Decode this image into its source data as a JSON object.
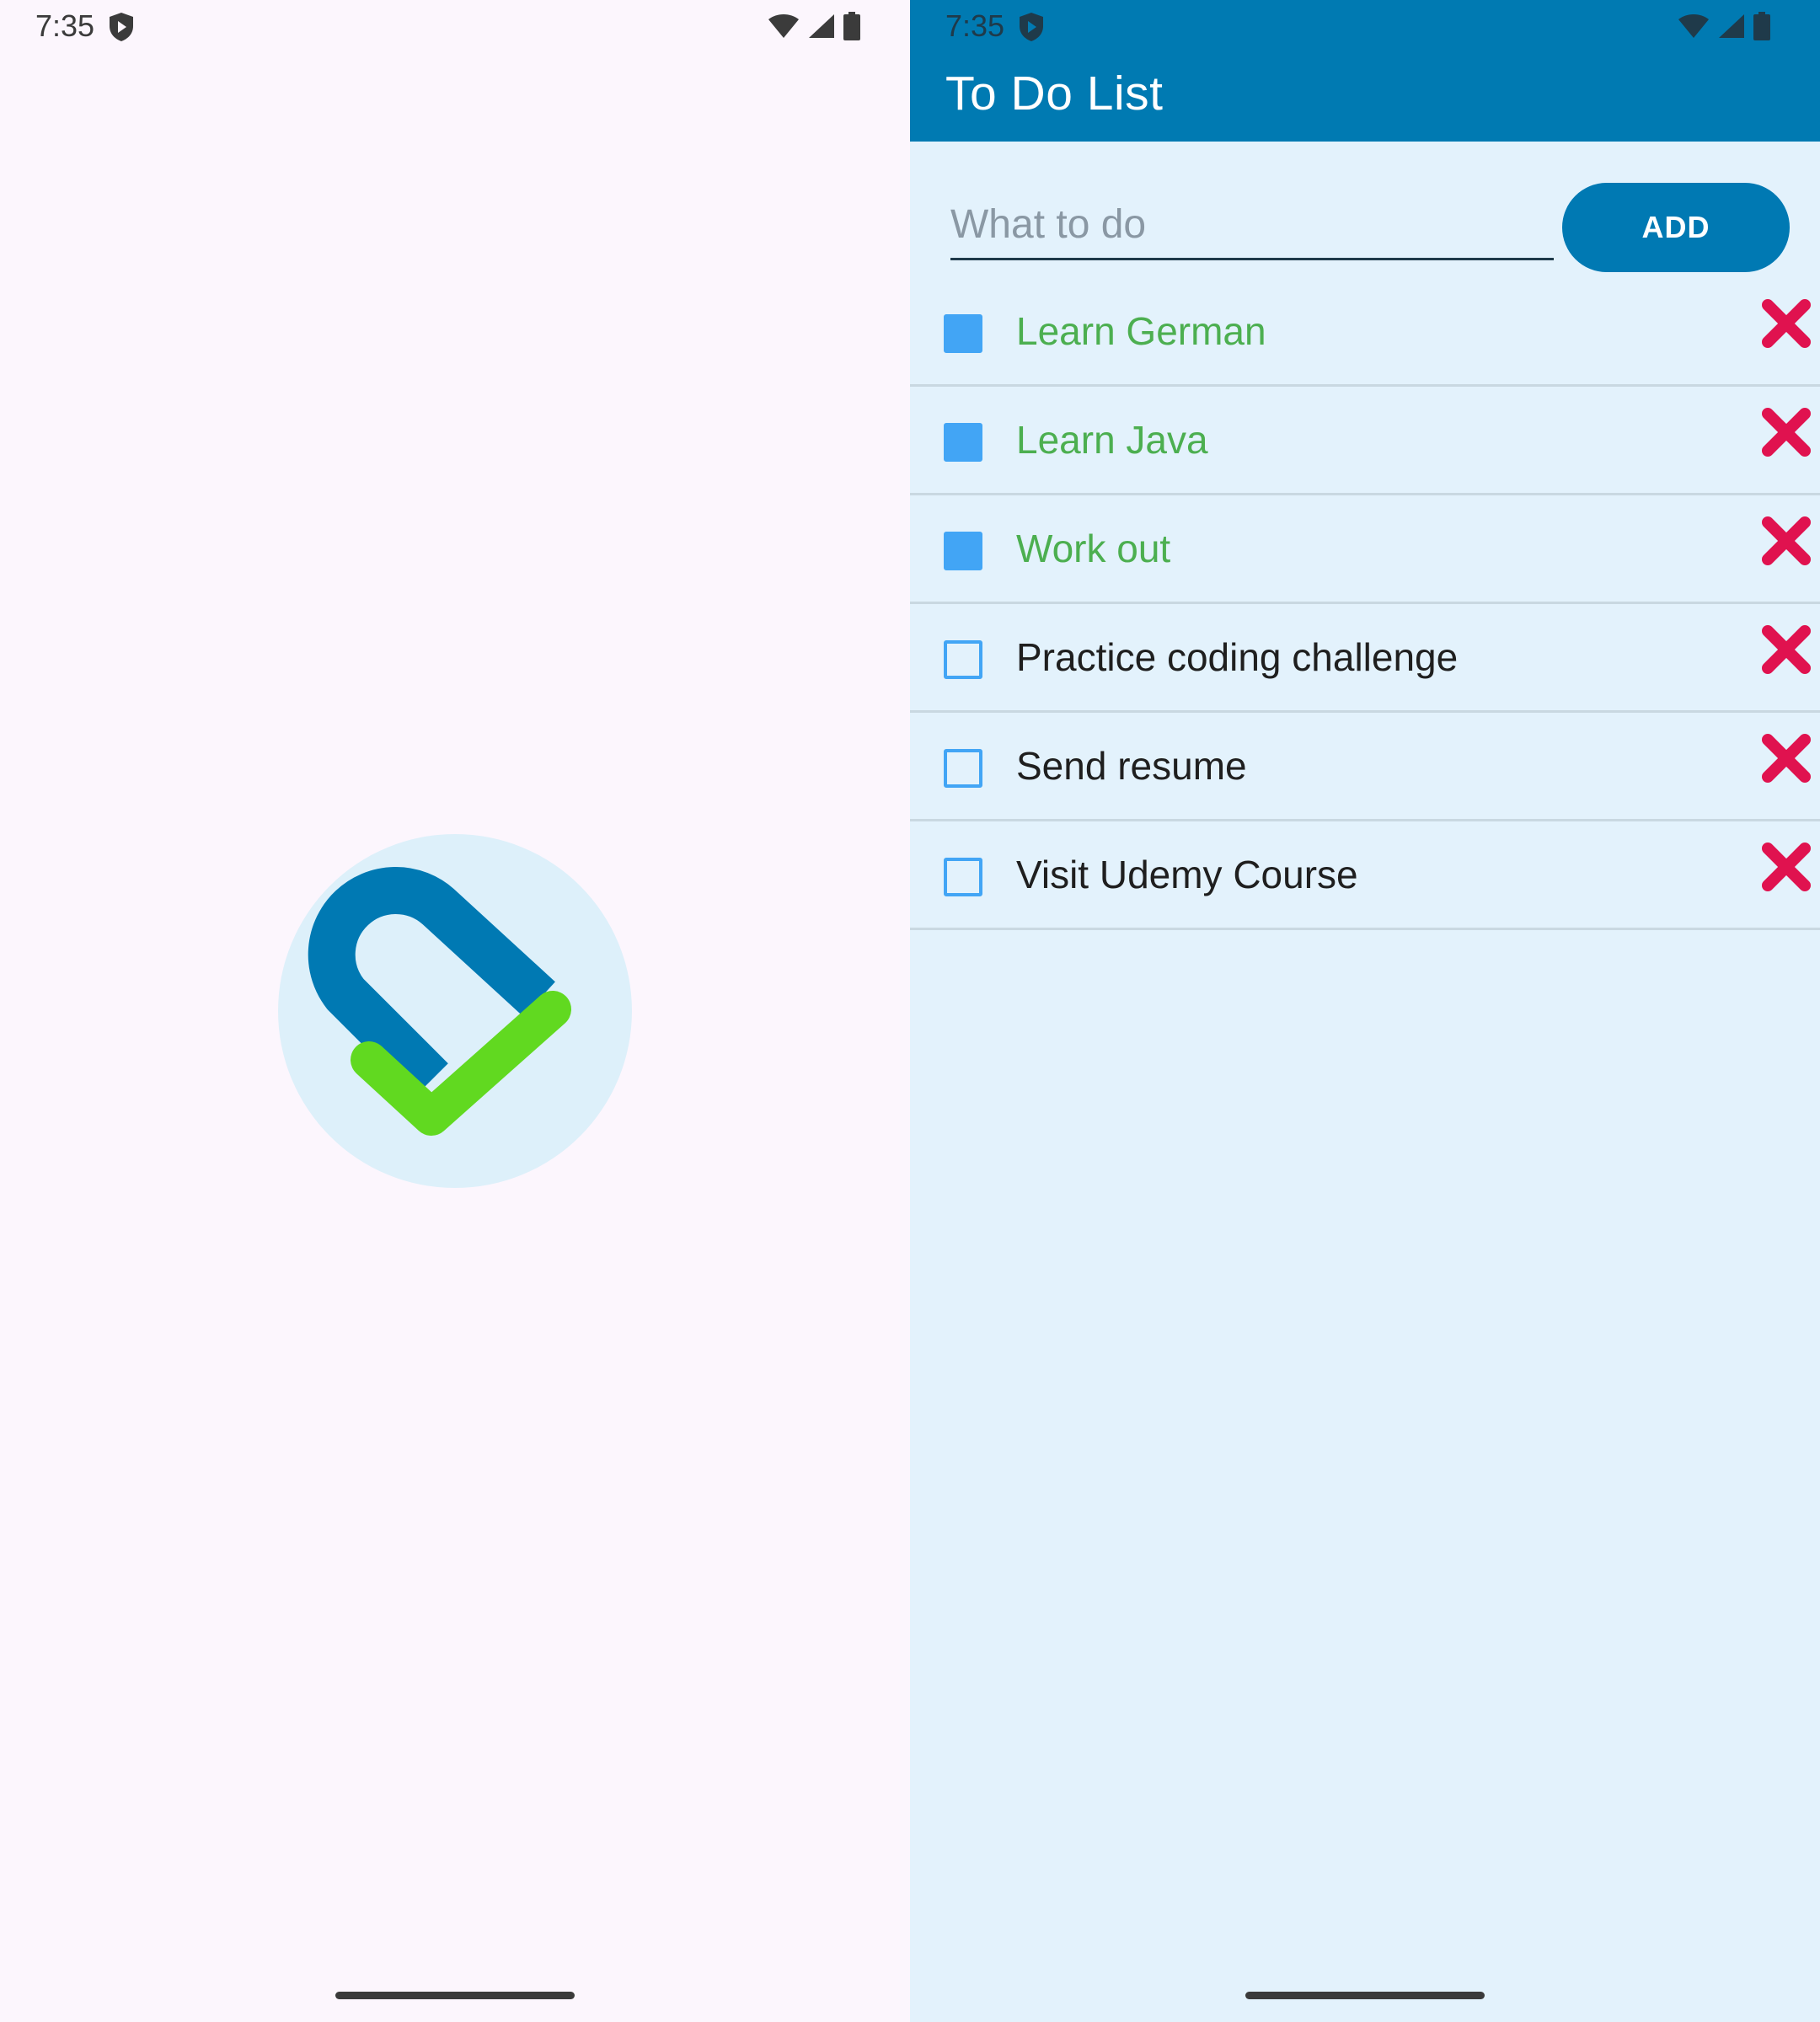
{
  "splash": {
    "status_bar": {
      "time": "7:35"
    },
    "logo": {
      "icon": "check-logo-icon",
      "colors": {
        "circle": "#DDF0FA",
        "blue": "#0079B3",
        "green": "#61D920"
      }
    }
  },
  "app": {
    "status_bar": {
      "time": "7:35"
    },
    "header": {
      "title": "To Do List",
      "color": "#007AB2"
    },
    "input": {
      "placeholder": "What to do",
      "value": ""
    },
    "add_button": {
      "label": "ADD"
    },
    "items": [
      {
        "text": "Learn German",
        "checked": true
      },
      {
        "text": "Learn Java",
        "checked": true
      },
      {
        "text": "Work out",
        "checked": true
      },
      {
        "text": "Practice coding challenge",
        "checked": false
      },
      {
        "text": "Send resume",
        "checked": false
      },
      {
        "text": "Visit Udemy Course",
        "checked": false
      }
    ],
    "colors": {
      "done_text": "#4CAF50",
      "checkbox": "#42A5F5",
      "delete": "#E0124F",
      "background": "#E3F2FC"
    }
  }
}
